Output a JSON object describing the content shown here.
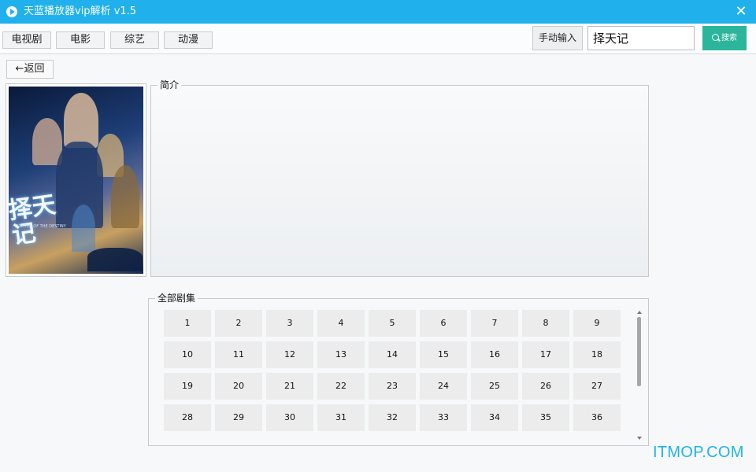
{
  "window": {
    "title": "天蓝播放器vip解析 v1.5",
    "close_glyph": "✕"
  },
  "nav": {
    "tabs": [
      "电视剧",
      "电影",
      "综艺",
      "动漫"
    ],
    "manual_input_label": "手动输入",
    "search_value": "择天记",
    "search_button_label": "搜索"
  },
  "back_label": "←返回",
  "poster": {
    "title_art": "择天记",
    "subtitle_art": "FIGHTER OF THE DESTINY"
  },
  "intro": {
    "label": "简介",
    "text": ""
  },
  "episodes": {
    "label": "全部剧集",
    "items": [
      "1",
      "2",
      "3",
      "4",
      "5",
      "6",
      "7",
      "8",
      "9",
      "10",
      "11",
      "12",
      "13",
      "14",
      "15",
      "16",
      "17",
      "18",
      "19",
      "20",
      "21",
      "22",
      "23",
      "24",
      "25",
      "26",
      "27",
      "28",
      "29",
      "30",
      "31",
      "32",
      "33",
      "34",
      "35",
      "36"
    ]
  },
  "watermark": "ITMOP.COM",
  "colors": {
    "titlebar": "#20b1ec",
    "search_button": "#2bb69b",
    "watermark": "#1fb3ea"
  }
}
